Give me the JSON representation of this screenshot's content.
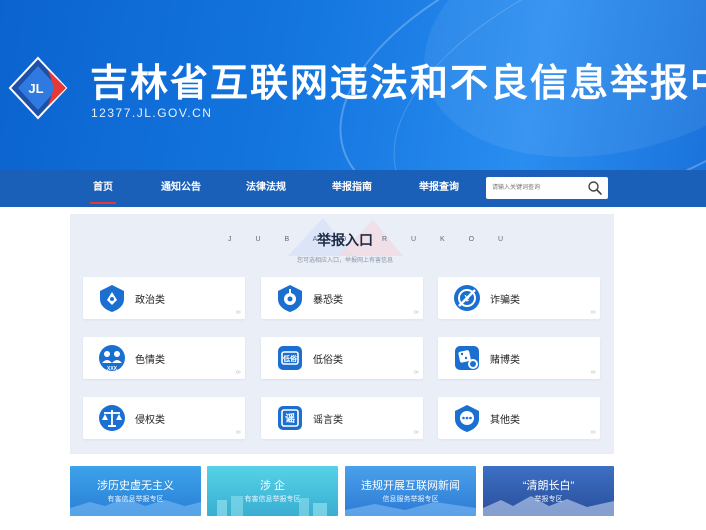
{
  "header": {
    "logo_text": "JL",
    "title": "吉林省互联网违法和不良信息举报中心",
    "domain": "12377.JL.GOV.CN"
  },
  "nav": {
    "items": [
      {
        "label": "首页",
        "active": true
      },
      {
        "label": "通知公告",
        "active": false
      },
      {
        "label": "法律法规",
        "active": false
      },
      {
        "label": "举报指南",
        "active": false
      },
      {
        "label": "举报查询",
        "active": false
      }
    ],
    "search_placeholder": "请输入关键词查询"
  },
  "report_panel": {
    "pinyin_left": "J U B A O",
    "pinyin_right": "R U K O U",
    "title": "举报入口",
    "subtitle": "您可选相应入口，举报网上有害信息",
    "categories": [
      {
        "label": "政治类",
        "icon": "political-icon"
      },
      {
        "label": "暴恐类",
        "icon": "terror-icon"
      },
      {
        "label": "诈骗类",
        "icon": "fraud-icon"
      },
      {
        "label": "色情类",
        "icon": "porn-icon"
      },
      {
        "label": "低俗类",
        "icon": "vulgar-icon"
      },
      {
        "label": "赌博类",
        "icon": "gambling-icon"
      },
      {
        "label": "侵权类",
        "icon": "infringement-icon"
      },
      {
        "label": "谣言类",
        "icon": "rumor-icon"
      },
      {
        "label": "其他类",
        "icon": "other-icon"
      }
    ],
    "card_arrow": "»»"
  },
  "features": [
    {
      "line1": "涉历史虚无主义",
      "line2": "有害信息举报专区"
    },
    {
      "line1": "涉 企",
      "line2": "有害信息举报专区"
    },
    {
      "line1": "违规开展互联网新闻",
      "line2": "信息服务举报专区"
    },
    {
      "line1": "“清朗长白”",
      "line2": "举报专区"
    }
  ],
  "colors": {
    "banner_blue": "#1577e0",
    "nav_blue": "#1a5fb8",
    "icon_blue": "#1a6fd1",
    "active_red": "#e53935"
  }
}
